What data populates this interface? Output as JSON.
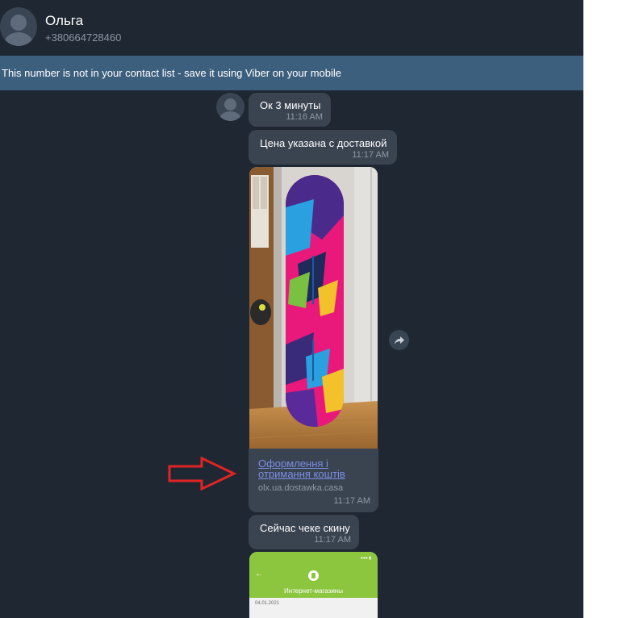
{
  "header": {
    "contact_name": "Ольга",
    "phone": "+380664728460"
  },
  "banner": {
    "text": "This number is not in your contact list - save it using Viber on your mobile"
  },
  "messages": [
    {
      "text": "Ок 3 минуты",
      "time": "11:16 AM"
    },
    {
      "text": "Цена указана с доставкой",
      "time": "11:17 AM"
    },
    {
      "type": "link",
      "link_title": "Оформлення і отримання коштів",
      "domain": "olx.ua.dostawka.casa",
      "time": "11:17 AM"
    },
    {
      "text": "Сейчас чеке скину",
      "time": "11:17 AM"
    },
    {
      "type": "image",
      "screenshot_title": "Интернет-магазины",
      "screenshot_date": "04.01.2021"
    }
  ],
  "colors": {
    "app_background": "#1f2732",
    "banner": "#3d5f7e",
    "bubble": "#3a4350",
    "link": "#7b8fe6",
    "annotation_arrow": "#e02424"
  },
  "icons": [
    "default-avatar-icon",
    "share-forward-icon",
    "red-arrow-annotation"
  ]
}
